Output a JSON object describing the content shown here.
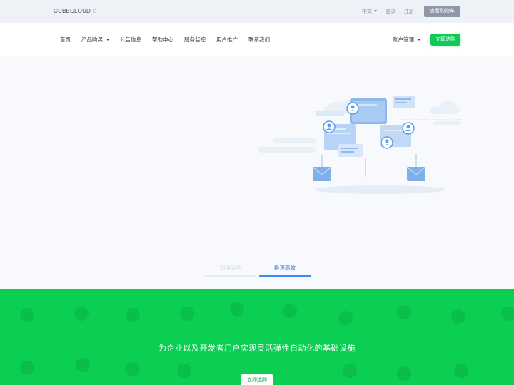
{
  "topbar": {
    "brand": "CUBECLOUD",
    "language": "中文",
    "login": "登录",
    "register": "注册",
    "cart_button": "查看购物车"
  },
  "nav": {
    "items": [
      {
        "label": "首页"
      },
      {
        "label": "产品购买"
      },
      {
        "label": "公告信息"
      },
      {
        "label": "帮助中心"
      },
      {
        "label": "服务监控"
      },
      {
        "label": "用户推广"
      },
      {
        "label": "联系我们"
      }
    ],
    "account": "账户管理",
    "buy_button": "立即选购"
  },
  "hero": {
    "tabs": [
      {
        "label": "四海云地",
        "active": false
      },
      {
        "label": "极速高效",
        "active": true
      }
    ]
  },
  "band": {
    "slogan": "为企业以及开发者用户实现灵活弹性自动化的基础设施",
    "button": "立即选购"
  },
  "colors": {
    "accent_green": "#0acf52",
    "button_green": "#10c956",
    "active_tab_blue": "#3a8ef0",
    "topbar_bg": "#eef1f6",
    "cart_button_bg": "#8e97a6"
  }
}
